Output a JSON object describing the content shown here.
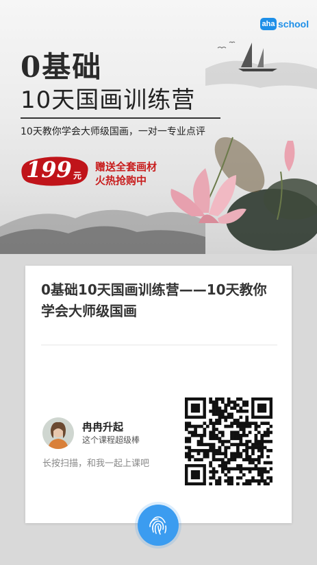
{
  "brand": {
    "badge": "aha",
    "name": "school",
    "color": "#1e8fe8"
  },
  "poster": {
    "title_line1": "0基础",
    "title_line2": "10天国画训练营",
    "subtitle": "10天教你学会大师级国画，一对一专业点评",
    "price": "199",
    "price_unit": "元",
    "promo_line1": "赠送全套画材",
    "promo_line2": "火热抢购中"
  },
  "card": {
    "course_title": "0基础10天国画训练营——10天教你学会大师级国画",
    "user": {
      "name": "冉冉升起",
      "desc": "这个课程超级棒"
    },
    "scan_hint": "长按扫描，和我一起上课吧"
  },
  "icons": {
    "fingerprint": "fingerprint-icon",
    "qr": "qr-code",
    "avatar": "user-avatar"
  },
  "colors": {
    "accent": "#3b9cf0",
    "price_red": "#c81d1d",
    "background": "#d9d9d9"
  }
}
